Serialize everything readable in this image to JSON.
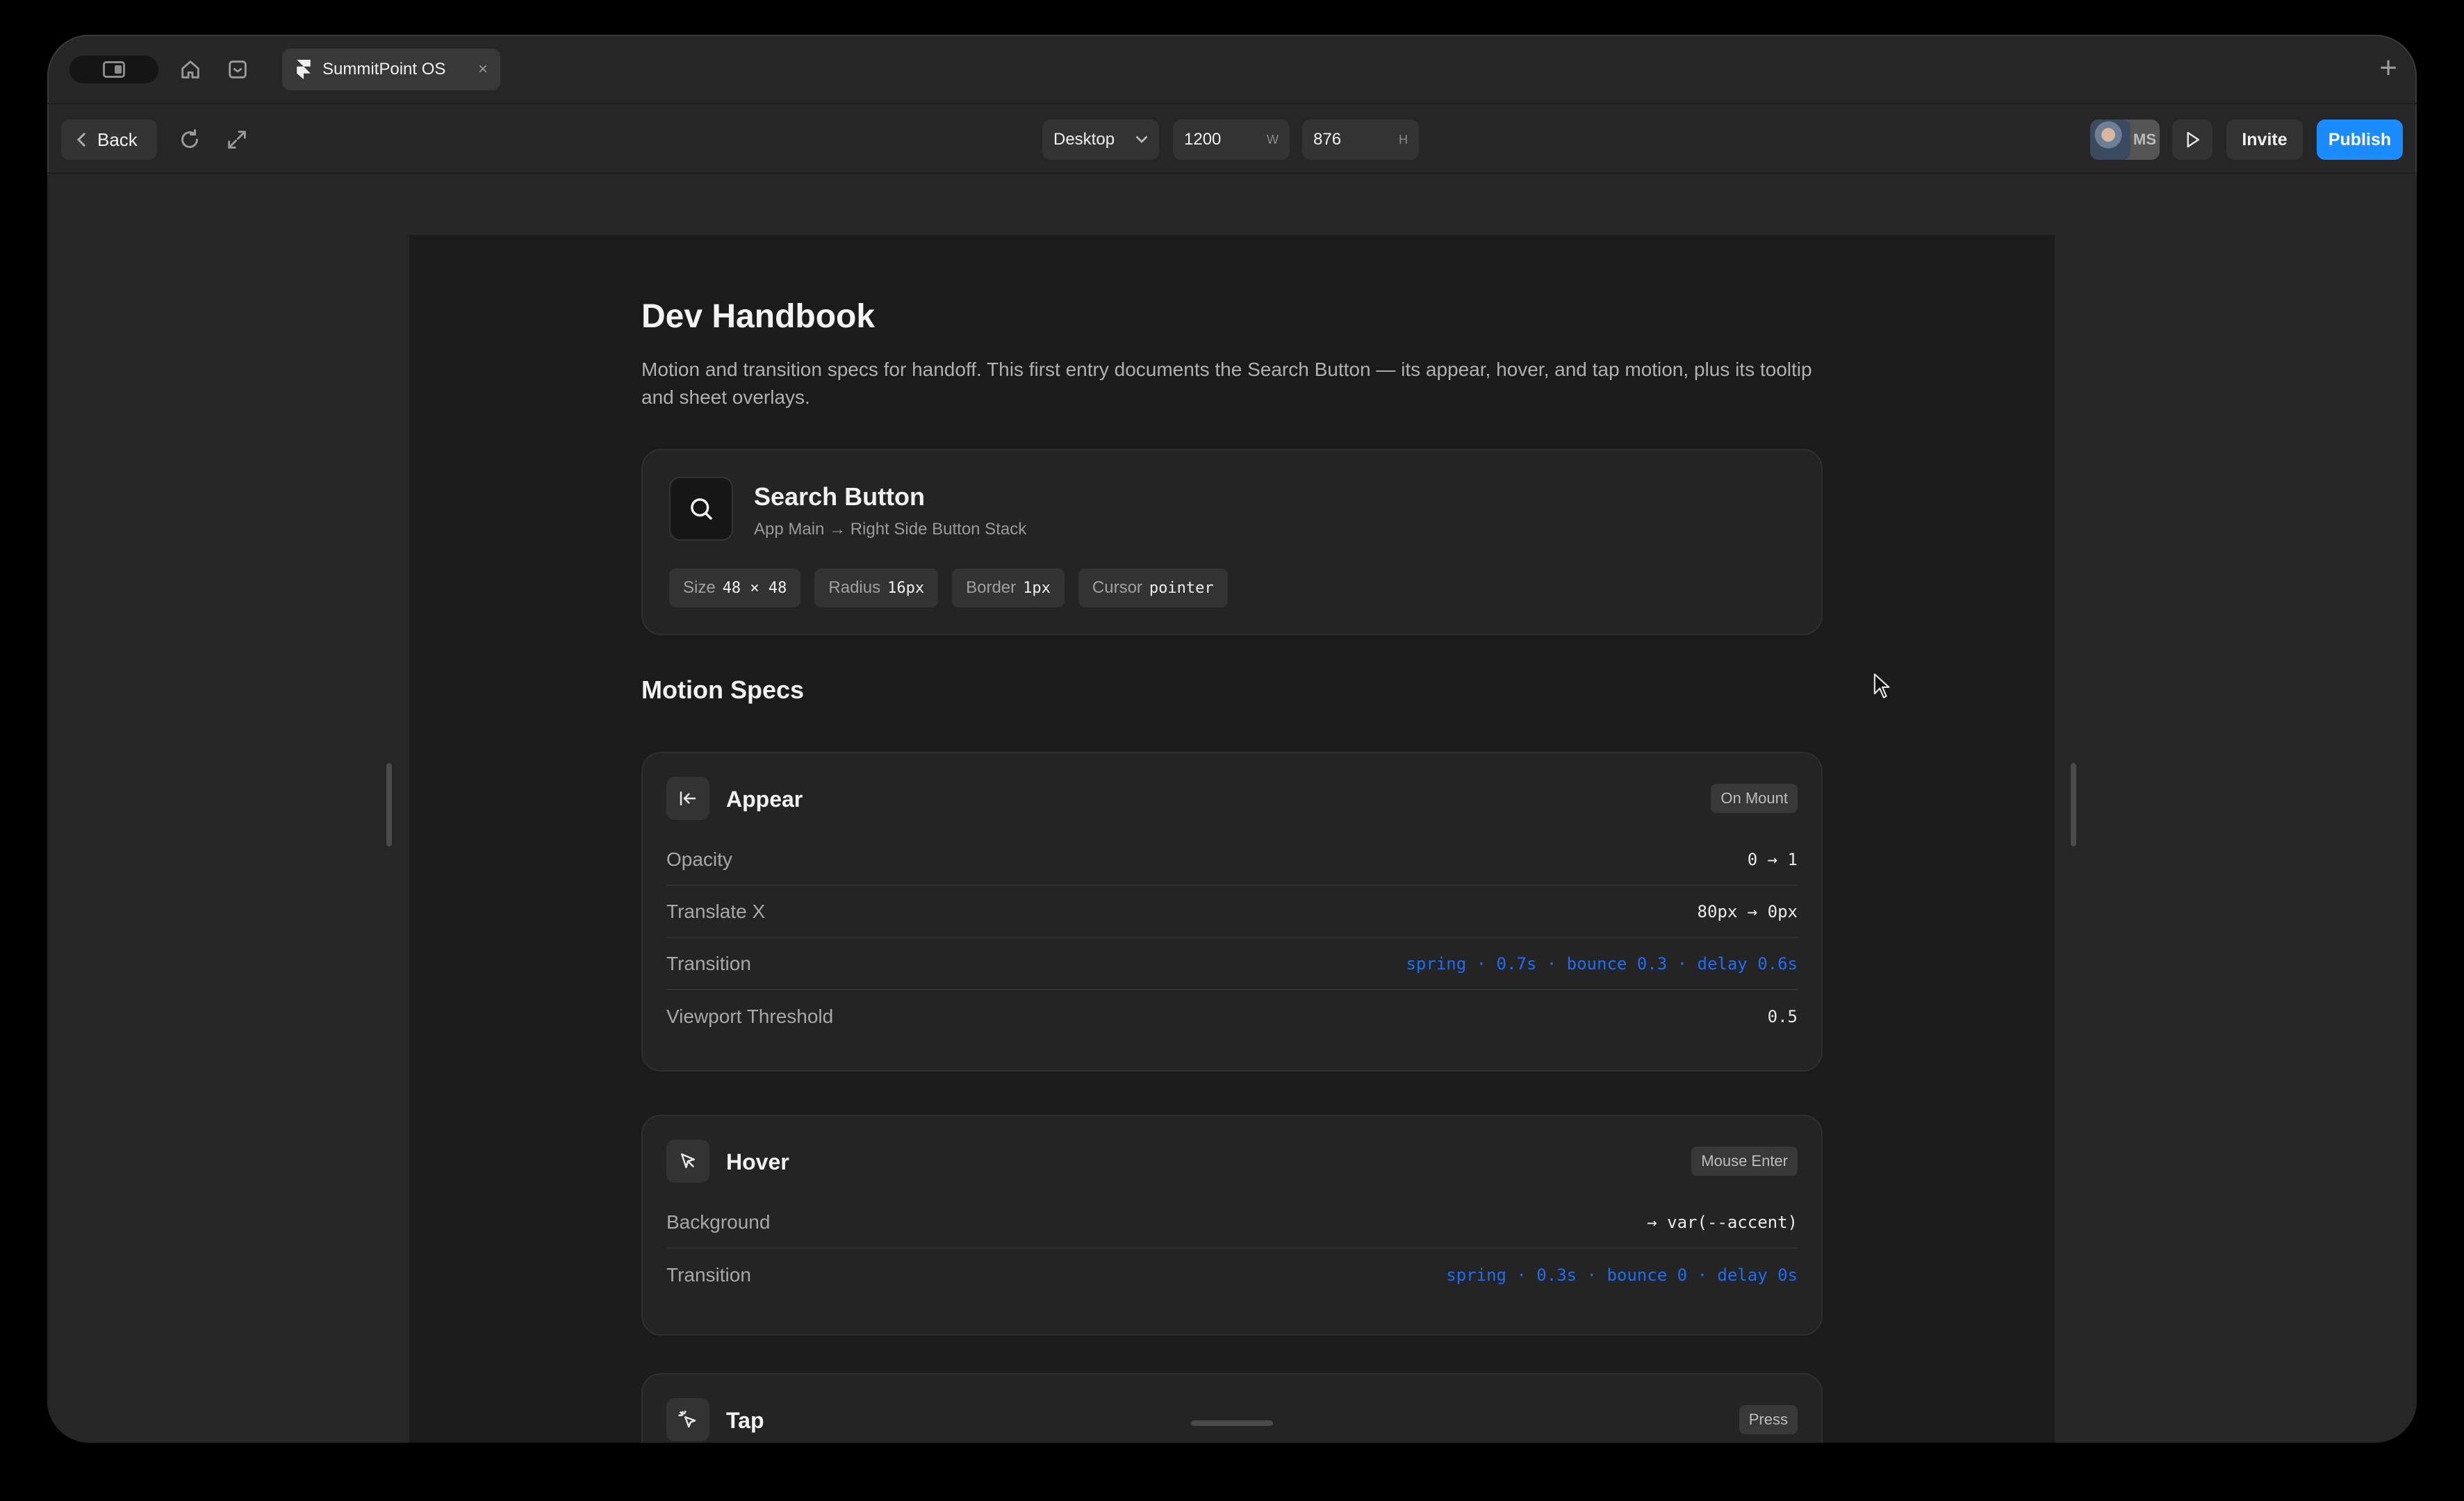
{
  "tabbar": {
    "tab_title": "SummitPoint OS",
    "tab_close": "×",
    "new_tab": "+"
  },
  "toolbar": {
    "back_label": "Back",
    "device": "Desktop",
    "width_value": "1200",
    "width_unit": "W",
    "height_value": "876",
    "height_unit": "H",
    "avatar_initials": "MS",
    "invite_label": "Invite",
    "publish_label": "Publish"
  },
  "page": {
    "title": "Dev Handbook",
    "intro": "Motion and transition specs for handoff. This first entry documents the Search Button — its appear, hover, and tap motion, plus its tooltip and sheet overlays.",
    "component": {
      "name": "Search Button",
      "path": "App Main → Right Side Button Stack",
      "props": [
        {
          "key": "Size",
          "value": "48 × 48"
        },
        {
          "key": "Radius",
          "value": "16px"
        },
        {
          "key": "Border",
          "value": "1px"
        },
        {
          "key": "Cursor",
          "value": "pointer"
        }
      ]
    },
    "section_title": "Motion Specs",
    "specs": [
      {
        "title": "Appear",
        "trigger": "On Mount",
        "rows": [
          {
            "key": "Opacity",
            "value": "0 → 1"
          },
          {
            "key": "Translate X",
            "value": "80px → 0px"
          },
          {
            "key": "Transition",
            "value": "spring · 0.7s · bounce 0.3 · delay 0.6s"
          },
          {
            "key": "Viewport Threshold",
            "value": "0.5"
          }
        ]
      },
      {
        "title": "Hover",
        "trigger": "Mouse Enter",
        "rows": [
          {
            "key": "Background",
            "value": "→ var(--accent)"
          },
          {
            "key": "Transition",
            "value": "spring · 0.3s · bounce 0 · delay 0s"
          }
        ]
      },
      {
        "title": "Tap",
        "trigger": "Press",
        "rows": []
      }
    ]
  },
  "colors": {
    "accent": "#1a8cff",
    "transition_text": "#1d6ef5",
    "frame_bg": "#1b1b1b",
    "chrome_bg": "#262626"
  }
}
